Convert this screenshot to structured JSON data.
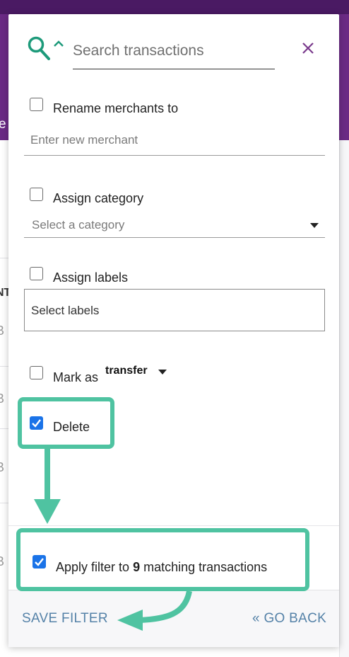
{
  "background": {
    "header_fragment": "e",
    "column_fragment": "NT",
    "row_fragment": "B"
  },
  "search": {
    "placeholder": "Search transactions",
    "icon": "search-icon",
    "toggle_icon": "chevron-up-icon",
    "close_icon": "close-icon"
  },
  "rename": {
    "checked": false,
    "label": "Rename merchants to",
    "placeholder": "Enter new merchant"
  },
  "category": {
    "checked": false,
    "label": "Assign category",
    "placeholder": "Select a category"
  },
  "labels": {
    "checked": false,
    "label": "Assign labels",
    "placeholder": "Select labels"
  },
  "transfer": {
    "checked": false,
    "label": "Mark as",
    "value": "transfer"
  },
  "delete": {
    "checked": true,
    "label": "Delete"
  },
  "apply": {
    "checked": true,
    "label_prefix": "Apply filter to",
    "count": "9",
    "label_suffix": "matching transactions"
  },
  "footer": {
    "save_label": "SAVE FILTER",
    "back_label": "« GO BACK"
  },
  "colors": {
    "accent_teal": "#4fc3a1",
    "header_purple": "#6a2a84",
    "link_blue": "#5582a8",
    "checkbox_blue": "#1a73e8",
    "close_purple": "#7a3a8c"
  }
}
